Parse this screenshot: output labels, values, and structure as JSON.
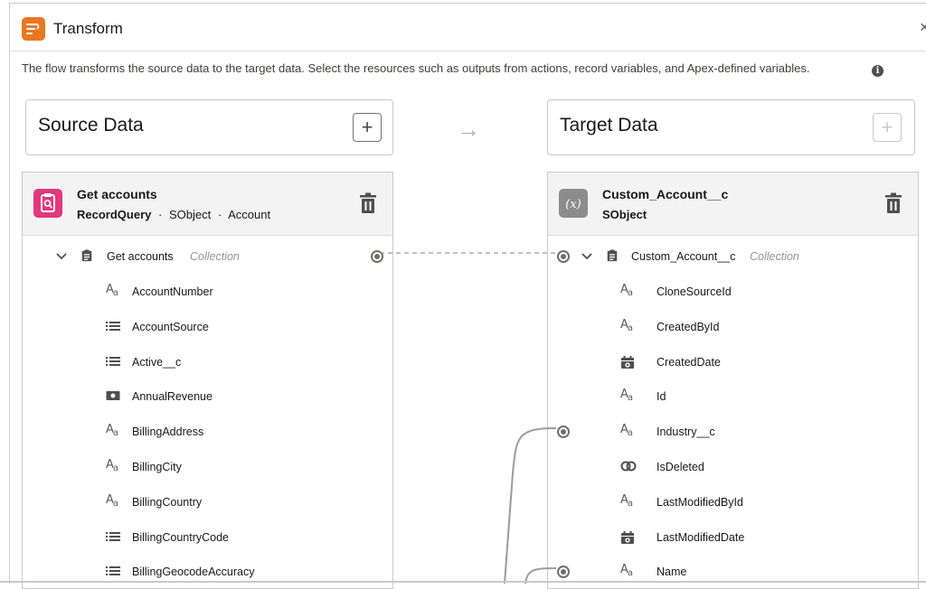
{
  "header": {
    "title": "Transform",
    "close_label": "×"
  },
  "description": "The flow transforms the source data to the target data. Select the resources such as outputs from actions, record variables, and Apex-defined variables.",
  "info_icon": "info-icon",
  "source": {
    "title": "Source Data",
    "add_label": "+",
    "object": {
      "name": "Get accounts",
      "type_bold": "RecordQuery",
      "sub1": "SObject",
      "sub2": "Account",
      "sep": "·"
    },
    "collection": {
      "label": "Get accounts",
      "kind": "Collection"
    },
    "fields": [
      {
        "label": "AccountNumber",
        "icon": "text-icon"
      },
      {
        "label": "AccountSource",
        "icon": "picklist-icon"
      },
      {
        "label": "Active__c",
        "icon": "picklist-icon"
      },
      {
        "label": "AnnualRevenue",
        "icon": "currency-icon"
      },
      {
        "label": "BillingAddress",
        "icon": "text-icon"
      },
      {
        "label": "BillingCity",
        "icon": "text-icon"
      },
      {
        "label": "BillingCountry",
        "icon": "text-icon"
      },
      {
        "label": "BillingCountryCode",
        "icon": "picklist-icon"
      },
      {
        "label": "BillingGeocodeAccuracy",
        "icon": "picklist-icon"
      }
    ]
  },
  "target": {
    "title": "Target Data",
    "add_label": "+",
    "object": {
      "name": "Custom_Account__c",
      "type_bold": "SObject"
    },
    "collection": {
      "label": "Custom_Account__c",
      "kind": "Collection"
    },
    "fields": [
      {
        "label": "CloneSourceId",
        "icon": "text-icon"
      },
      {
        "label": "CreatedById",
        "icon": "text-icon"
      },
      {
        "label": "CreatedDate",
        "icon": "date-icon"
      },
      {
        "label": "Id",
        "icon": "text-icon"
      },
      {
        "label": "Industry__c",
        "icon": "text-icon"
      },
      {
        "label": "IsDeleted",
        "icon": "boolean-icon"
      },
      {
        "label": "LastModifiedById",
        "icon": "text-icon"
      },
      {
        "label": "LastModifiedDate",
        "icon": "date-icon"
      },
      {
        "label": "Name",
        "icon": "text-icon"
      }
    ]
  },
  "arrow": "→",
  "colors": {
    "brand_orange": "#e87722",
    "source_icon_pink": "#e3377f",
    "target_icon_gray": "#8c8c8c"
  }
}
